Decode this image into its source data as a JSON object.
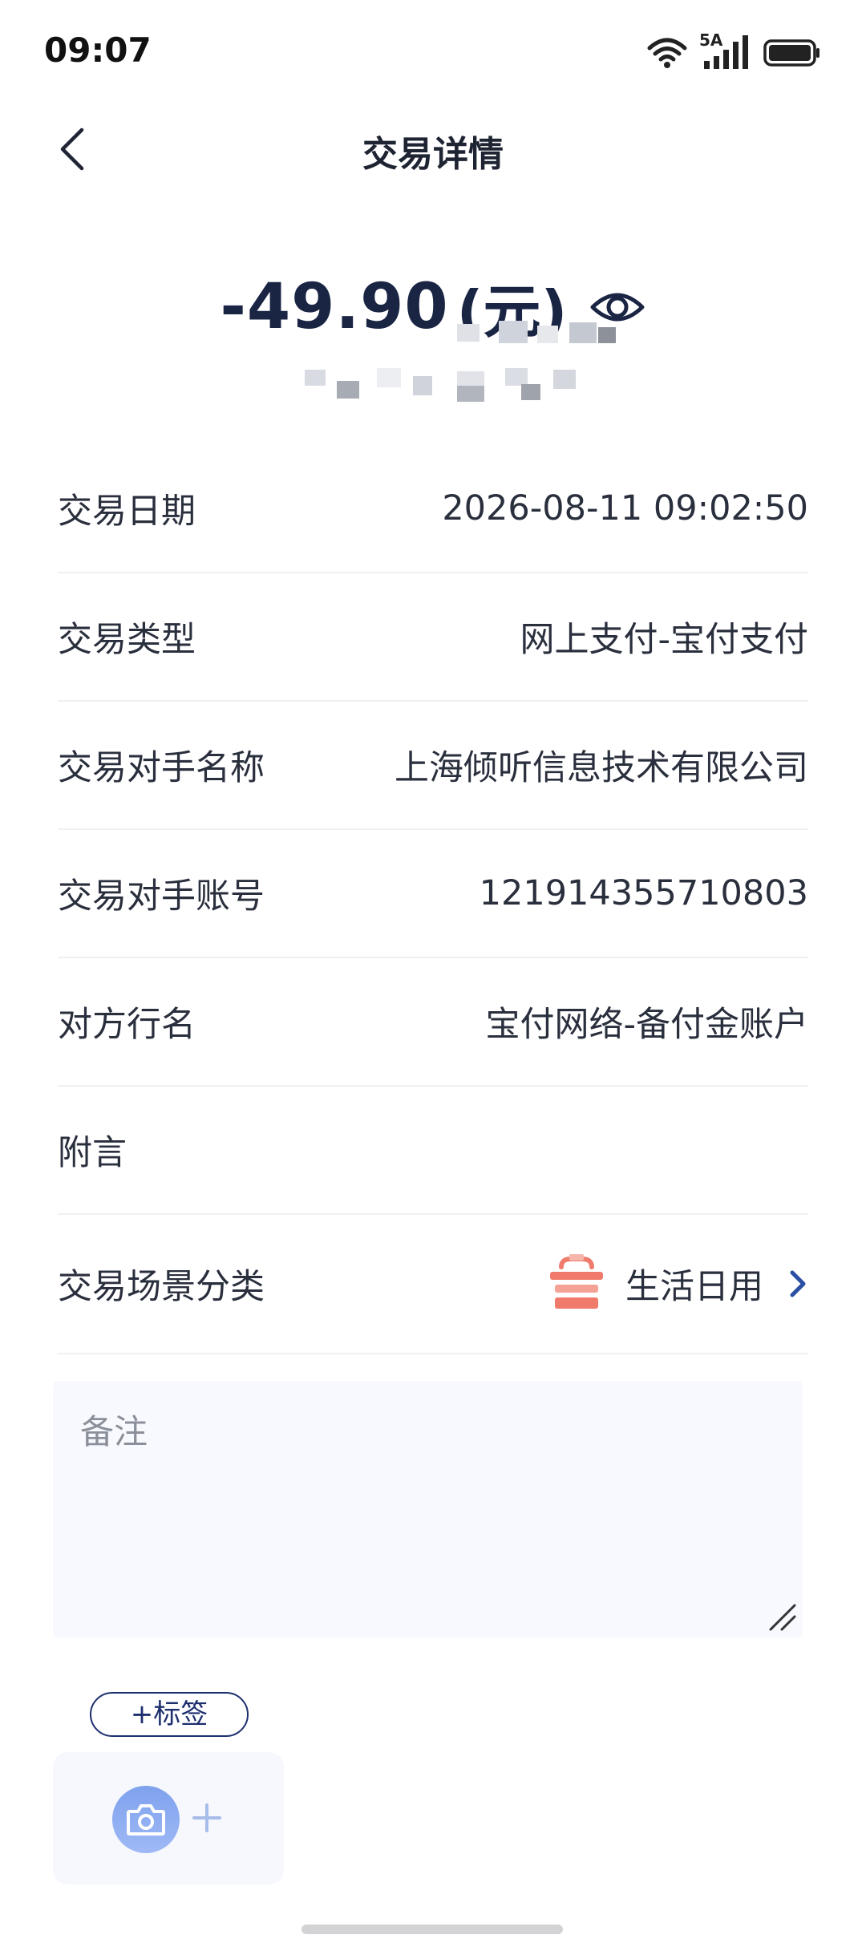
{
  "status_bar": {
    "time": "09:07",
    "network_label": "5A",
    "icons": [
      "wifi-icon",
      "signal-icon",
      "battery-icon"
    ]
  },
  "nav": {
    "title": "交易详情",
    "back_icon": "chevron-left-icon"
  },
  "amount": {
    "value": "-49.90",
    "unit": "(元)",
    "eye_icon": "eye-icon"
  },
  "details": [
    {
      "label": "交易日期",
      "value": "2026-08-11 09:02:50"
    },
    {
      "label": "交易类型",
      "value": "网上支付-宝付支付"
    },
    {
      "label": "交易对手名称",
      "value": "上海倾听信息技术有限公司"
    },
    {
      "label": "交易对手账号",
      "value": "121914355710803"
    },
    {
      "label": "对方行名",
      "value": "宝付网络-备付金账户"
    },
    {
      "label": "附言",
      "value": ""
    }
  ],
  "scene": {
    "label": "交易场景分类",
    "value": "生活日用",
    "icon": "hanger-icon"
  },
  "memo": {
    "placeholder": "备注",
    "value": ""
  },
  "tag_button": {
    "label": "+标签"
  },
  "photo": {
    "icon": "camera-icon",
    "add_icon": "plus-icon"
  },
  "colors": {
    "accent": "#1d2f6e",
    "amount": "#1a2544",
    "scene_icon": "#f07a6c",
    "chevron": "#2a4fa3",
    "memo_bg": "#f7f9fe"
  }
}
